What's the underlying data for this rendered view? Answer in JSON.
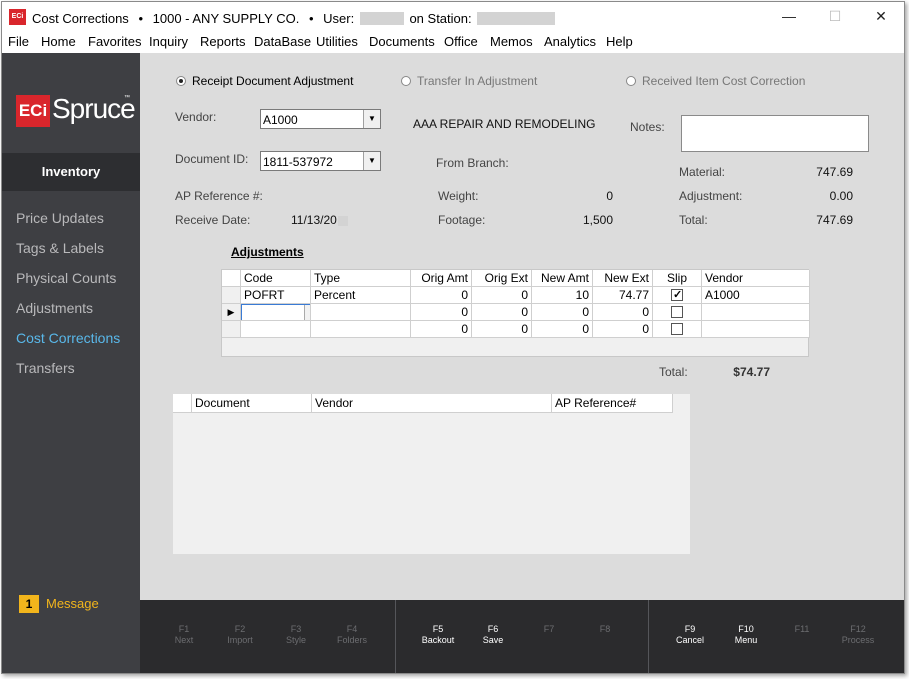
{
  "titlebar": {
    "app": "Cost Corrections",
    "sep1": "•",
    "company": "1000 - ANY SUPPLY CO.",
    "sep2": "•",
    "user_label": "User:",
    "station_label": "on Station:"
  },
  "window_controls": {
    "minimize": "—",
    "maximize": "☐",
    "close": "✕"
  },
  "menu": [
    "File",
    "Home",
    "Favorites",
    "Inquiry",
    "Reports",
    "DataBase",
    "Utilities",
    "Documents",
    "Office",
    "Memos",
    "Analytics",
    "Help"
  ],
  "sidebar": {
    "logo_eci": "ECi",
    "logo_spruce": "Spruce",
    "logo_tm": "™",
    "section": "Inventory",
    "items": [
      "Price Updates",
      "Tags & Labels",
      "Physical Counts",
      "Adjustments",
      "Cost Corrections",
      "Transfers"
    ],
    "active_item": "Cost Corrections",
    "message_count": "1",
    "message_label": "Message"
  },
  "form": {
    "radio_options": [
      "Receipt Document Adjustment",
      "Transfer In Adjustment",
      "Received Item Cost Correction"
    ],
    "selected_radio": "Receipt Document Adjustment",
    "vendor_label": "Vendor:",
    "vendor_value": "A1000",
    "vendor_name": "AAA REPAIR AND REMODELING",
    "notes_label": "Notes:",
    "document_id_label": "Document ID:",
    "document_id_value": "1811-537972",
    "from_branch_label": "From Branch:",
    "ap_reference_label": "AP Reference #:",
    "receive_date_label": "Receive Date:",
    "receive_date_value": "11/13/20",
    "weight_label": "Weight:",
    "weight_value": "0",
    "footage_label": "Footage:",
    "footage_value": "1,500",
    "material_label": "Material:",
    "material_value": "747.69",
    "adjustment_label": "Adjustment:",
    "adjustment_value": "0.00",
    "total_label": "Total:",
    "total_value": "747.69"
  },
  "adjustments": {
    "title": "Adjustments",
    "columns": [
      "Code",
      "Type",
      "Orig Amt",
      "Orig Ext",
      "New Amt",
      "New Ext",
      "Slip",
      "Vendor"
    ],
    "rows": [
      {
        "code": "POFRT",
        "type": "Percent",
        "orig_amt": "0",
        "orig_ext": "0",
        "new_amt": "10",
        "new_ext": "74.77",
        "slip": true,
        "vendor": "A1000"
      },
      {
        "code": "",
        "type": "",
        "orig_amt": "0",
        "orig_ext": "0",
        "new_amt": "0",
        "new_ext": "0",
        "slip": false,
        "vendor": ""
      },
      {
        "code": "",
        "type": "",
        "orig_amt": "0",
        "orig_ext": "0",
        "new_amt": "0",
        "new_ext": "0",
        "slip": false,
        "vendor": ""
      }
    ],
    "total_label": "Total:",
    "total_value": "$74.77"
  },
  "documents": {
    "columns": [
      "Document",
      "Vendor",
      "AP Reference#"
    ]
  },
  "fkeys": [
    {
      "key": "F1",
      "label": "Next",
      "enabled": false
    },
    {
      "key": "F2",
      "label": "Import",
      "enabled": false
    },
    {
      "key": "F3",
      "label": "Style",
      "enabled": false
    },
    {
      "key": "F4",
      "label": "Folders",
      "enabled": false
    },
    {
      "key": "F5",
      "label": "Backout",
      "enabled": true
    },
    {
      "key": "F6",
      "label": "Save",
      "enabled": true
    },
    {
      "key": "F7",
      "label": "",
      "enabled": false
    },
    {
      "key": "F8",
      "label": "",
      "enabled": false
    },
    {
      "key": "F9",
      "label": "Cancel",
      "enabled": true
    },
    {
      "key": "F10",
      "label": "Menu",
      "enabled": true
    },
    {
      "key": "F11",
      "label": "",
      "enabled": false
    },
    {
      "key": "F12",
      "label": "Process",
      "enabled": false
    }
  ],
  "colors": {
    "brand_red": "#d9262c",
    "sidebar_bg": "#3e3f43",
    "active_nav": "#59b8ea",
    "message_badge": "#f2b51c",
    "fbar_bg": "#2b2b2d"
  }
}
